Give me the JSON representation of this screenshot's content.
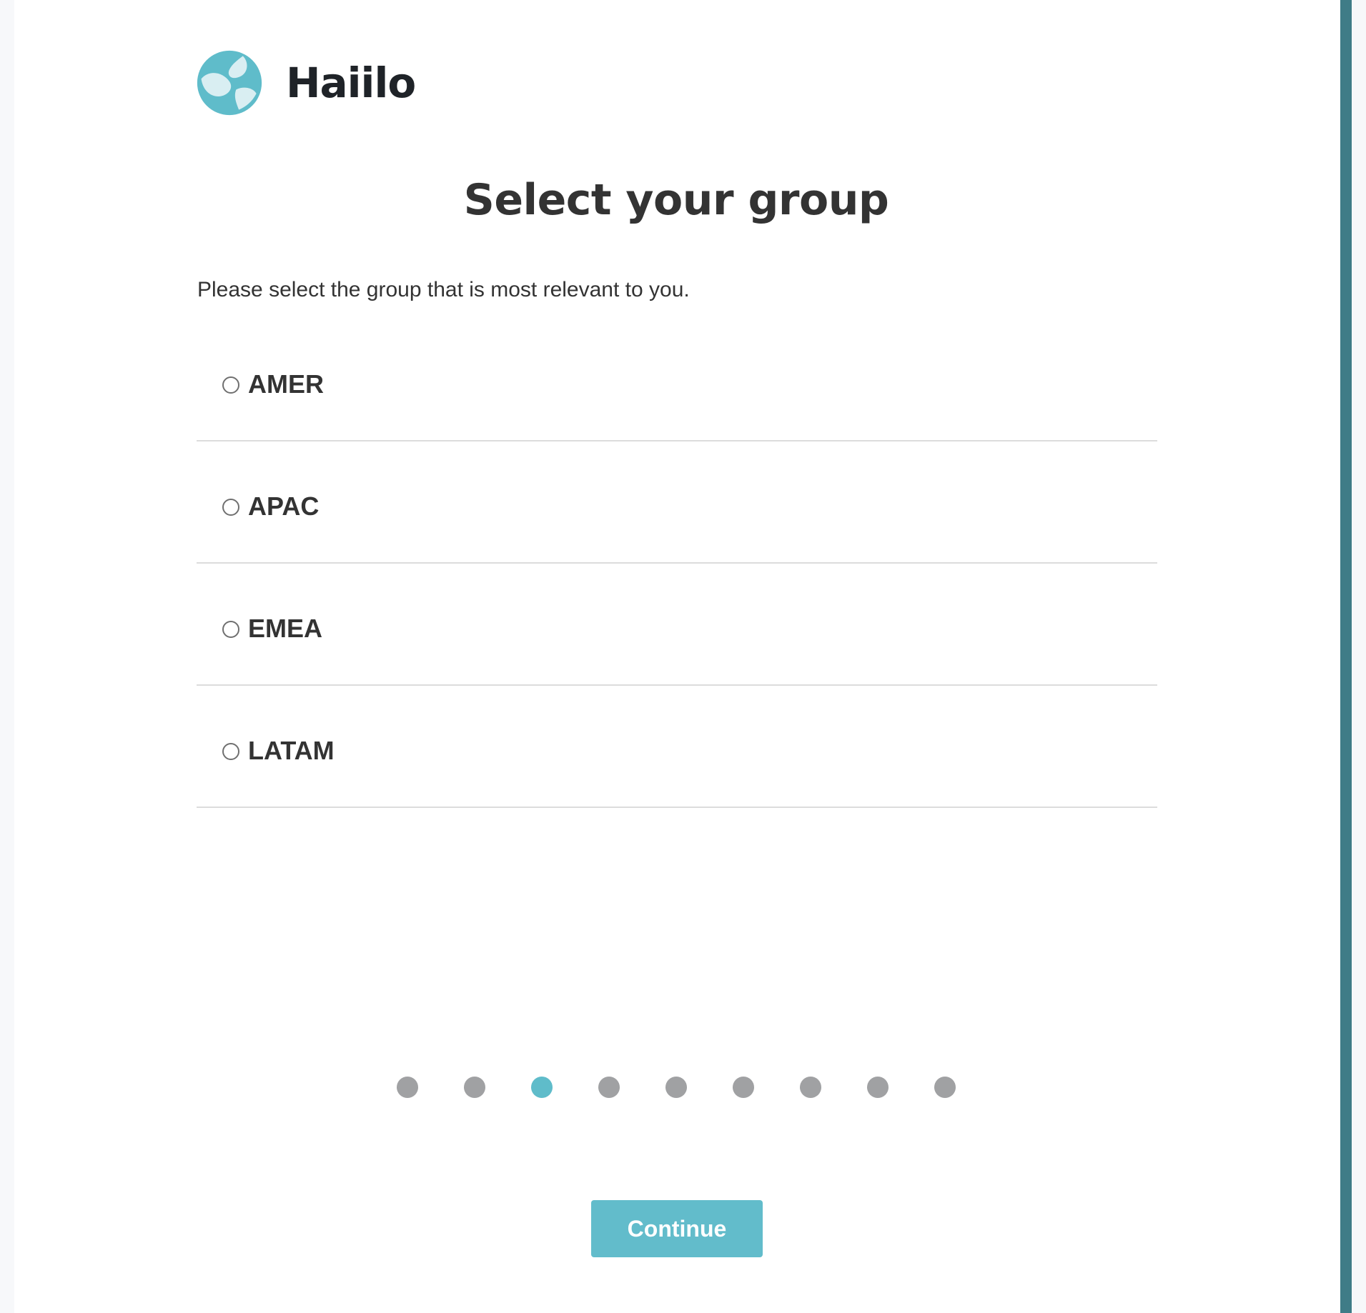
{
  "brand": {
    "name": "Haiilo",
    "logo_icon": "haiilo-swirl-logo",
    "logo_colors": [
      "#5fbcca",
      "#d9eef2"
    ]
  },
  "title": "Select your group",
  "subtitle": "Please select the group that is most relevant to you.",
  "groups": [
    {
      "label": "AMER",
      "selected": false
    },
    {
      "label": "APAC",
      "selected": false
    },
    {
      "label": "EMEA",
      "selected": false
    },
    {
      "label": "LATAM",
      "selected": false
    }
  ],
  "pager": {
    "total_steps": 9,
    "current_step": 3
  },
  "continue_label": "Continue",
  "colors": {
    "accent": "#5fbcca",
    "button": "#62bccb",
    "inactive_dot": "#a0a1a3",
    "side_strip": "#3f7c87",
    "text": "#333333"
  }
}
